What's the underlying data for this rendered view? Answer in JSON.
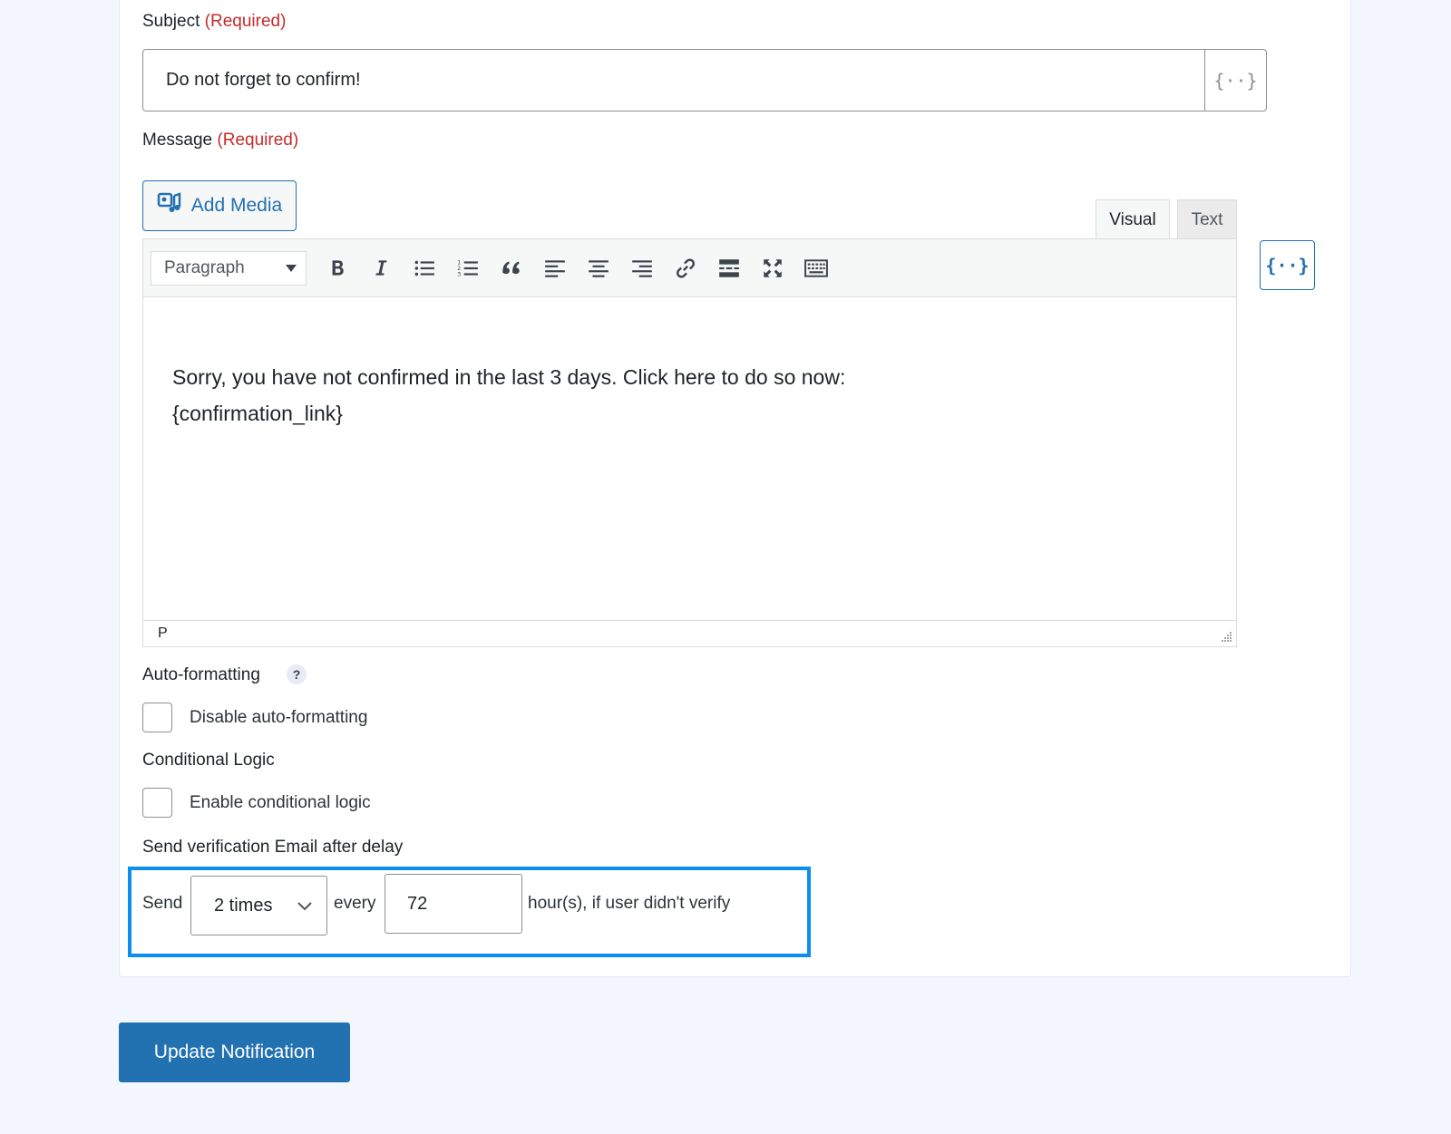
{
  "subject": {
    "label": "Subject",
    "required": "(Required)",
    "value": "Do not forget to confirm!",
    "merge_tag": "{··}"
  },
  "message": {
    "label": "Message",
    "required": "(Required)",
    "add_media": "Add Media",
    "tabs": {
      "visual": "Visual",
      "text": "Text"
    },
    "format": "Paragraph",
    "body_line1": "Sorry, you have not confirmed in the last 3 days. Click here to do so now:",
    "body_line2": "{confirmation_link}",
    "status_path": "P",
    "merge_tag": "{··}"
  },
  "toolbar_icons": [
    "bold-icon",
    "italic-icon",
    "bullet-list-icon",
    "numbered-list-icon",
    "blockquote-icon",
    "align-left-icon",
    "align-center-icon",
    "align-right-icon",
    "link-icon",
    "read-more-icon",
    "fullscreen-icon",
    "keyboard-icon"
  ],
  "auto_formatting": {
    "label": "Auto-formatting",
    "help": "?",
    "checkbox_label": "Disable auto-formatting",
    "checked": false
  },
  "conditional_logic": {
    "label": "Conditional Logic",
    "checkbox_label": "Enable conditional logic",
    "checked": false
  },
  "delay": {
    "label": "Send verification Email after delay",
    "send_text": "Send",
    "times": "2 times",
    "every_text": "every",
    "hours": "72",
    "suffix": "hour(s), if user didn't verify"
  },
  "update_button": "Update Notification",
  "colors": {
    "accent": "#2271b1",
    "required": "#c42b2b",
    "highlight": "#0a8ef0",
    "page_bg": "#f3f7fd"
  }
}
